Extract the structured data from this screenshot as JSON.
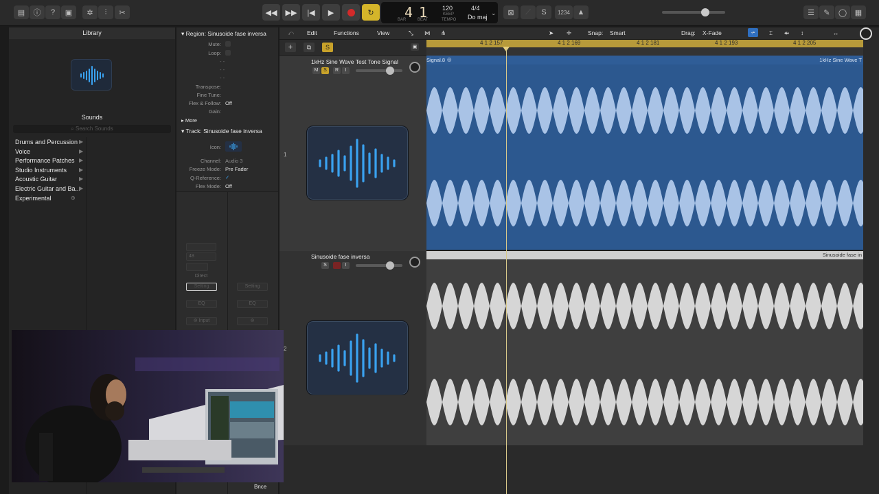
{
  "colors": {
    "ruler": "#b79a3a",
    "region_audio_blue": "#2c588f",
    "waveform_light": "#a9c3e6",
    "waveform_gray": "#d6d6d6",
    "record_red": "#d42a2a",
    "cycle_yellow": "#d5b52a",
    "solo_yellow": "#c8a22a",
    "icon_blue": "#3aa2f0"
  },
  "topbar": {
    "icons": [
      "library-icon",
      "info-icon",
      "help-icon",
      "editors-icon",
      "settings-icon",
      "mixer-icon",
      "scissors-icon"
    ],
    "right_icons": [
      "list-icon",
      "note-pad-icon",
      "loop-browser-icon",
      "browser-icon"
    ]
  },
  "lcd": {
    "bar": "4",
    "beat": "1",
    "bar_label": "BAR",
    "beat_label": "BEAT",
    "tempo": "120",
    "keep_label": "KEEP",
    "tempo_label": "TEMPO",
    "time_sig": "4/4",
    "key": "Do maj"
  },
  "tools": {
    "count_in": "1234"
  },
  "library": {
    "title": "Library",
    "sounds_header": "Sounds",
    "search_placeholder": "Search Sounds",
    "items": [
      {
        "label": "Drums and Percussion"
      },
      {
        "label": "Voice"
      },
      {
        "label": "Performance Patches"
      },
      {
        "label": "Studio Instruments"
      },
      {
        "label": "Acoustic Guitar"
      },
      {
        "label": "Electric Guitar and Ba..."
      },
      {
        "label": "Experimental"
      }
    ]
  },
  "inspector": {
    "region_header": "Region: Sinusoide fase inversa",
    "region_rows": [
      {
        "label": "Mute:",
        "value": ""
      },
      {
        "label": "Loop:",
        "value": ""
      },
      {
        "label": "",
        "value": "-  -"
      },
      {
        "label": "",
        "value": "-  -"
      },
      {
        "label": "",
        "value": "-  -"
      },
      {
        "label": "Transpose:",
        "value": ""
      },
      {
        "label": "Fine Tune:",
        "value": ""
      },
      {
        "label": "Flex & Follow:",
        "value": "Off"
      },
      {
        "label": "Gain:",
        "value": ""
      }
    ],
    "more": "More",
    "track_header": "Track: Sinusoide fase inversa",
    "track_rows": [
      {
        "label": "Icon:",
        "value": ""
      },
      {
        "label": "Channel:",
        "value": "Audio 3"
      },
      {
        "label": "Freeze Mode:",
        "value": "Pre Fader"
      },
      {
        "label": "Q-Reference:",
        "value": "✓"
      },
      {
        "label": "Flex Mode:",
        "value": "Off"
      }
    ],
    "strip": {
      "gain_value": "48",
      "direct": "Direct",
      "setting_left": "Setting",
      "setting_right": "Setting",
      "eq_left": "EQ",
      "eq_right": "EQ",
      "input": "Input",
      "bounce": "Bnce"
    }
  },
  "tracks_menu": {
    "edit": "Edit",
    "functions": "Functions",
    "view": "View",
    "snap_label": "Snap:",
    "snap_value": "Smart",
    "drag_label": "Drag:",
    "drag_value": "X-Fade"
  },
  "ruler": {
    "labels": [
      "4 1 2 157",
      "4 1 2 169",
      "4 1 2 181",
      "4 1 2 193",
      "4 1 2 205"
    ]
  },
  "tracks": [
    {
      "number": "1",
      "name": "1kHz Sine Wave Test Tone Signal",
      "buttons": [
        "M",
        "S",
        "R",
        "I"
      ],
      "region_name_left": "Signal.8",
      "region_name_right": "1kHz Sine Wave T"
    },
    {
      "number": "2",
      "name": "Sinusoide fase inversa",
      "buttons": [
        "S",
        "",
        "I"
      ],
      "region_name_right": "Sinusoide fase in"
    }
  ]
}
